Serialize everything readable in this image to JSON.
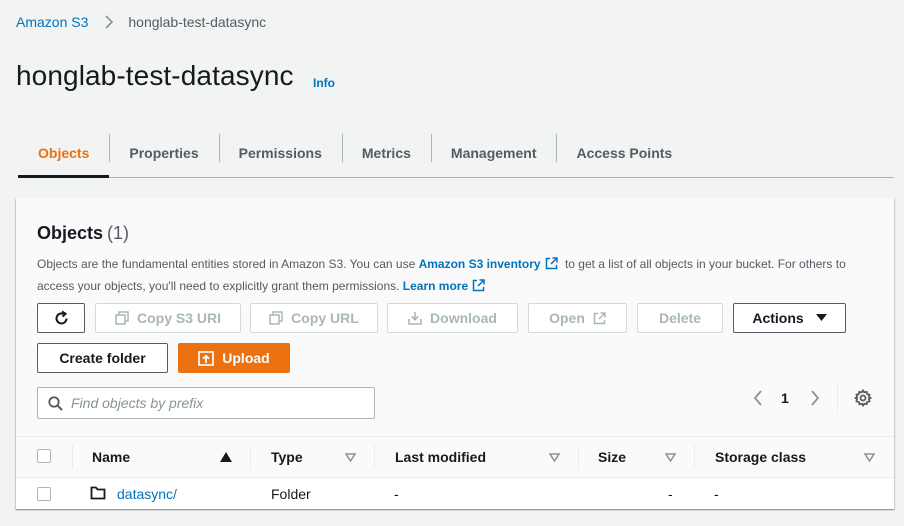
{
  "breadcrumb": {
    "root": "Amazon S3",
    "current": "honglab-test-datasync"
  },
  "page": {
    "title": "honglab-test-datasync",
    "info": "Info"
  },
  "tabs": [
    {
      "label": "Objects",
      "active": true
    },
    {
      "label": "Properties",
      "active": false
    },
    {
      "label": "Permissions",
      "active": false
    },
    {
      "label": "Metrics",
      "active": false
    },
    {
      "label": "Management",
      "active": false
    },
    {
      "label": "Access Points",
      "active": false
    }
  ],
  "objects": {
    "title": "Objects",
    "count": "(1)",
    "desc_part1": "Objects are the fundamental entities stored in Amazon S3. You can use ",
    "desc_link1": "Amazon S3 inventory",
    "desc_part2": " to get a list of all objects in your bucket. For others to access your objects, you'll need to explicitly grant them permissions. ",
    "desc_link2": "Learn more"
  },
  "toolbar": {
    "refresh_icon": "refresh-icon",
    "copy_uri": "Copy S3 URI",
    "copy_url": "Copy URL",
    "download": "Download",
    "open": "Open",
    "delete": "Delete",
    "actions": "Actions",
    "create_folder": "Create folder",
    "upload": "Upload"
  },
  "search": {
    "placeholder": "Find objects by prefix",
    "value": ""
  },
  "pagination": {
    "current_page": "1"
  },
  "table": {
    "columns": [
      "Name",
      "Type",
      "Last modified",
      "Size",
      "Storage class"
    ],
    "rows": [
      {
        "name": "datasync/",
        "type": "Folder",
        "last_modified": "-",
        "size": "-",
        "storage_class": "-"
      }
    ]
  },
  "colors": {
    "accent": "#ec7211",
    "link": "#0073bb",
    "text": "#16191f",
    "muted": "#545b64",
    "background": "#f2f3f3"
  }
}
